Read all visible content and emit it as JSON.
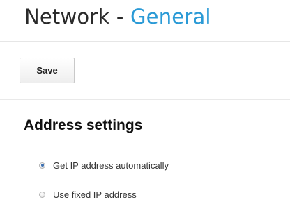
{
  "header": {
    "section": "Network",
    "separator": "-",
    "subsection": "General"
  },
  "toolbar": {
    "save_label": "Save"
  },
  "address_settings": {
    "heading": "Address settings",
    "options": [
      {
        "label": "Get IP address automatically",
        "selected": true
      },
      {
        "label": "Use fixed IP address",
        "selected": false
      }
    ]
  },
  "colors": {
    "accent": "#2a9ad6",
    "radio_selected": "#3c6fb0"
  }
}
